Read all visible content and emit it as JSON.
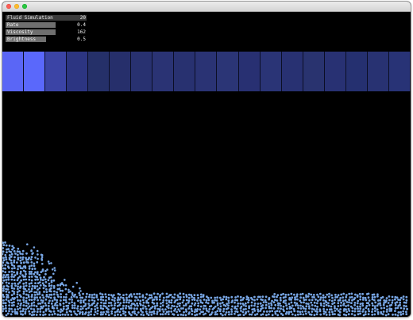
{
  "gui": {
    "title": {
      "label": "Fluid Simulation",
      "value": "20"
    },
    "params": [
      {
        "label": "Rate",
        "value": "0.4",
        "level": 0.62
      },
      {
        "label": "Viscosity",
        "value": "162",
        "level": 0.62
      },
      {
        "label": "Brightness",
        "value": "0.5",
        "level": 0.5
      }
    ]
  },
  "strip": {
    "colors": [
      "#5a66f6",
      "#5a68fb",
      "#3b44a6",
      "#2c3582",
      "#253069",
      "#262f6b",
      "#283170",
      "#2a3374",
      "#283170",
      "#2a3374",
      "#2b3576",
      "#283072",
      "#2a3476",
      "#283172",
      "#29336f",
      "#283173",
      "#253070",
      "#283272",
      "#283376"
    ]
  },
  "colors": {
    "particle": "#77a5e3",
    "background": "#000000"
  }
}
